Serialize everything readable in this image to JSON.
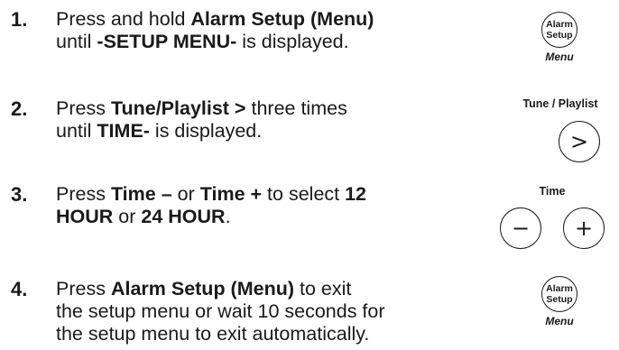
{
  "steps": [
    {
      "number": "1.",
      "line1": [
        "Press and hold ",
        "Alarm Setup (Menu)"
      ],
      "line2": [
        "until ",
        "-SETUP MENU-",
        " is displayed."
      ]
    },
    {
      "number": "2.",
      "line1": [
        "Press ",
        "Tune/Playlist >",
        " three times"
      ],
      "line2": [
        "until ",
        "TIME-",
        " is displayed."
      ]
    },
    {
      "number": "3.",
      "line1": [
        "Press ",
        "Time –",
        " or ",
        "Time +",
        " to select ",
        "12"
      ],
      "line2": [
        "HOUR",
        " or ",
        "24 HOUR",
        "."
      ]
    },
    {
      "number": "4.",
      "line1": [
        "Press ",
        "Alarm Setup (Menu)",
        " to exit"
      ],
      "line2": "the setup menu or wait 10 seconds for",
      "line3": "the setup menu to exit automatically."
    }
  ],
  "controls": {
    "alarm_setup_top": {
      "line1": "Alarm",
      "line2": "Setup",
      "caption": "Menu"
    },
    "tune_playlist": {
      "label": "Tune / Playlist",
      "glyph": ">"
    },
    "time": {
      "label": "Time",
      "minus_glyph": "−",
      "plus_glyph": "+"
    },
    "alarm_setup_bottom": {
      "line1": "Alarm",
      "line2": "Setup",
      "caption": "Menu"
    }
  }
}
